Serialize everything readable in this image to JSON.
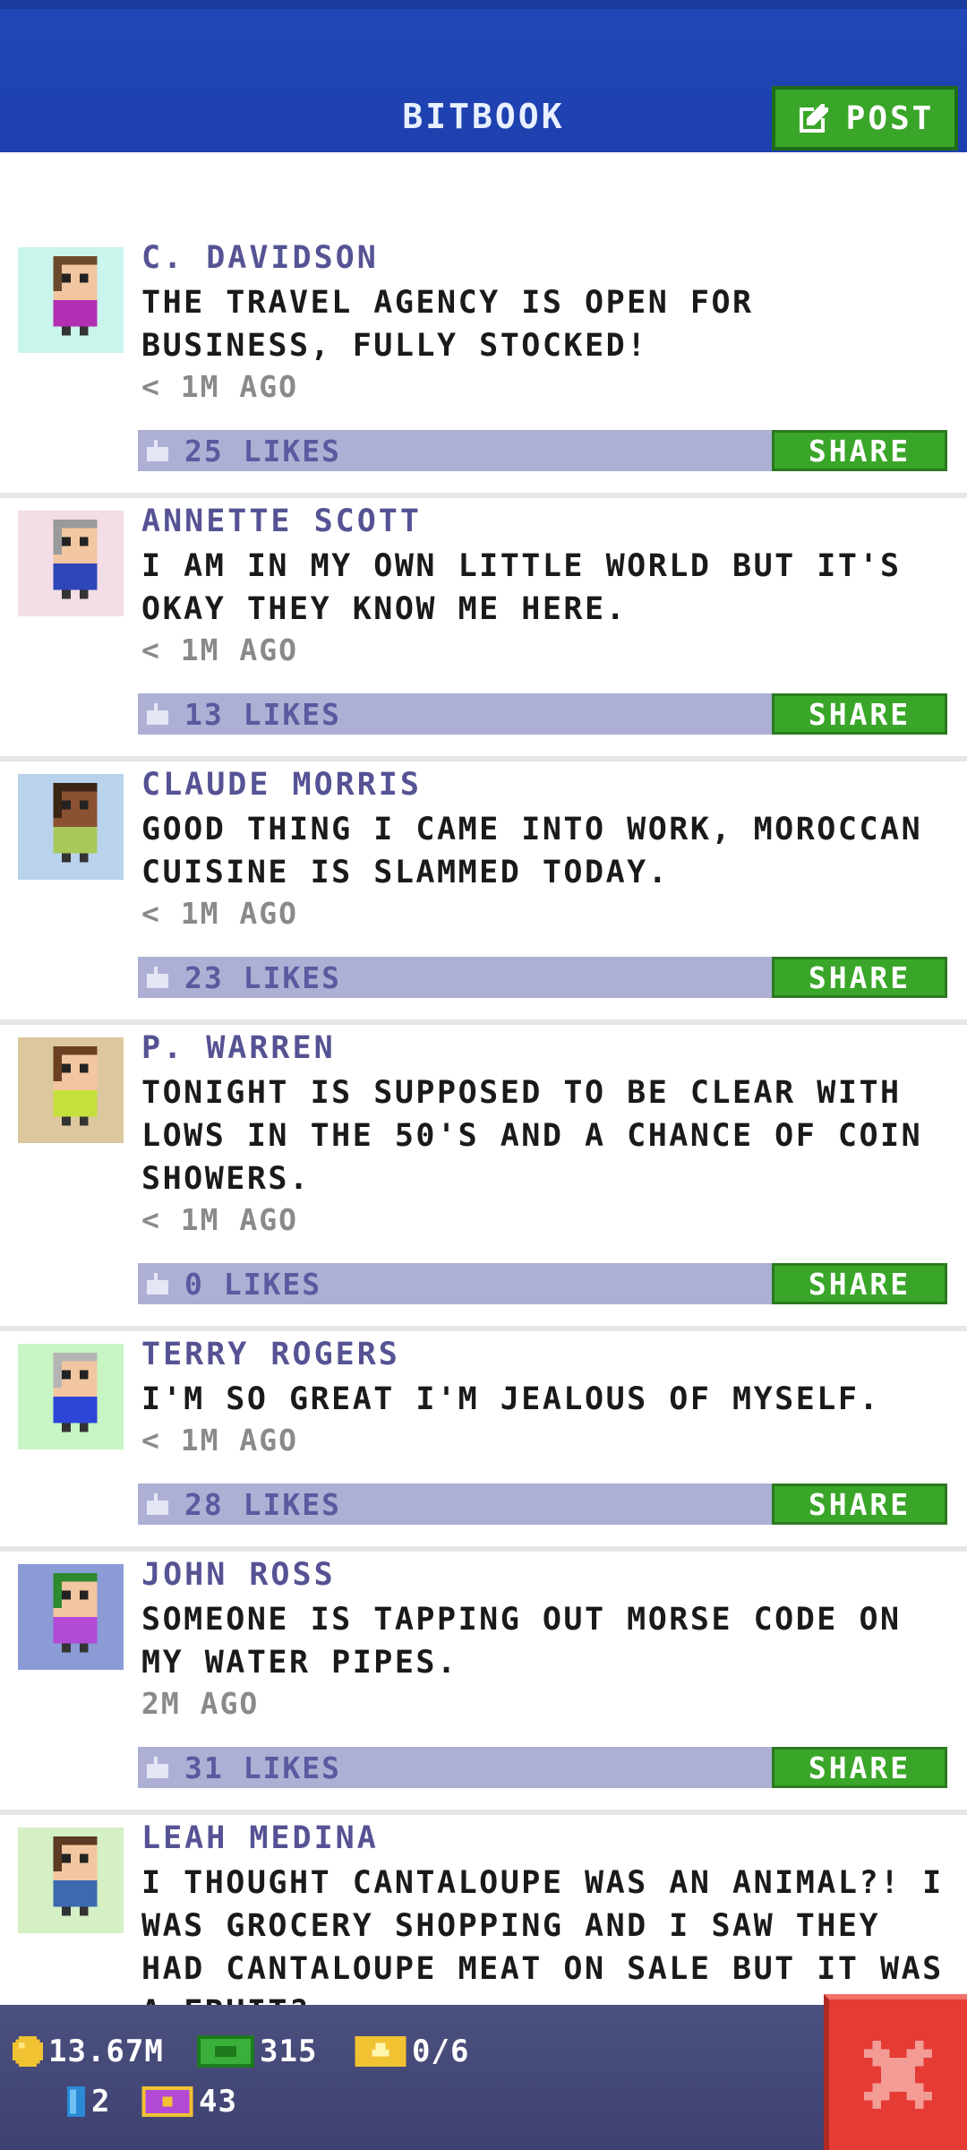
{
  "header": {
    "title": "BITBOOK",
    "post_label": "POST"
  },
  "posts": [
    {
      "name": "C. DAVIDSON",
      "body": "THE TRAVEL AGENCY IS OPEN FOR BUSINESS, FULLY STOCKED!",
      "time": "< 1M AGO",
      "likes": "25 LIKES",
      "share": "SHARE",
      "avatar_bg": "#c9f5ec",
      "shirt": "#b22fb3",
      "hair": "#6b4a2b",
      "skin": "#f2c6a0"
    },
    {
      "name": "ANNETTE SCOTT",
      "body": "I AM IN MY OWN LITTLE WORLD BUT IT'S OKAY THEY KNOW ME HERE.",
      "time": "< 1M AGO",
      "likes": "13 LIKES",
      "share": "SHARE",
      "avatar_bg": "#f3dde6",
      "shirt": "#2e46b8",
      "hair": "#9a9a9a",
      "skin": "#f2c6a0"
    },
    {
      "name": "CLAUDE MORRIS",
      "body": "GOOD THING I CAME INTO WORK, MOROCCAN CUISINE IS SLAMMED TODAY.",
      "time": "< 1M AGO",
      "likes": "23 LIKES",
      "share": "SHARE",
      "avatar_bg": "#b9d3ec",
      "shirt": "#a8c85a",
      "hair": "#3a2414",
      "skin": "#8a5232"
    },
    {
      "name": "P. WARREN",
      "body": "TONIGHT IS SUPPOSED TO BE CLEAR WITH LOWS IN THE 50'S AND A CHANCE OF COIN SHOWERS.",
      "time": "< 1M AGO",
      "likes": "0 LIKES",
      "share": "SHARE",
      "avatar_bg": "#dcc79f",
      "shirt": "#c4e03a",
      "hair": "#6b3f22",
      "skin": "#f2c6a0"
    },
    {
      "name": "TERRY ROGERS",
      "body": "I'M SO GREAT I'M JEALOUS OF MYSELF.",
      "time": "< 1M AGO",
      "likes": "28 LIKES",
      "share": "SHARE",
      "avatar_bg": "#c8f5c4",
      "shirt": "#2e46d8",
      "hair": "#b5b5b5",
      "skin": "#f2c6a0"
    },
    {
      "name": "JOHN ROSS",
      "body": "SOMEONE IS TAPPING OUT MORSE CODE ON MY WATER PIPES.",
      "time": "2M AGO",
      "likes": "31 LIKES",
      "share": "SHARE",
      "avatar_bg": "#8a9bd6",
      "shirt": "#b24ad6",
      "hair": "#2d8a2f",
      "skin": "#f2c6a0"
    },
    {
      "name": "LEAH MEDINA",
      "body": "I THOUGHT CANTALOUPE WAS AN ANIMAL?! I WAS GROCERY SHOPPING AND I SAW THEY HAD CANTALOUPE MEAT ON SALE BUT IT WAS A FRUIT?",
      "time": "",
      "likes": "",
      "share": "",
      "avatar_bg": "#d4f0c4",
      "shirt": "#3c6ab0",
      "hair": "#5a3a22",
      "skin": "#f2c6a0"
    }
  ],
  "status": {
    "coins": "13.67M",
    "bux": "315",
    "tickets": "0/6",
    "elevator": "2",
    "vip": "43"
  },
  "colors": {
    "topbar": "#1f47b6",
    "green": "#3aa629",
    "likes_bar": "#adb0d4",
    "close": "#e53b34"
  }
}
